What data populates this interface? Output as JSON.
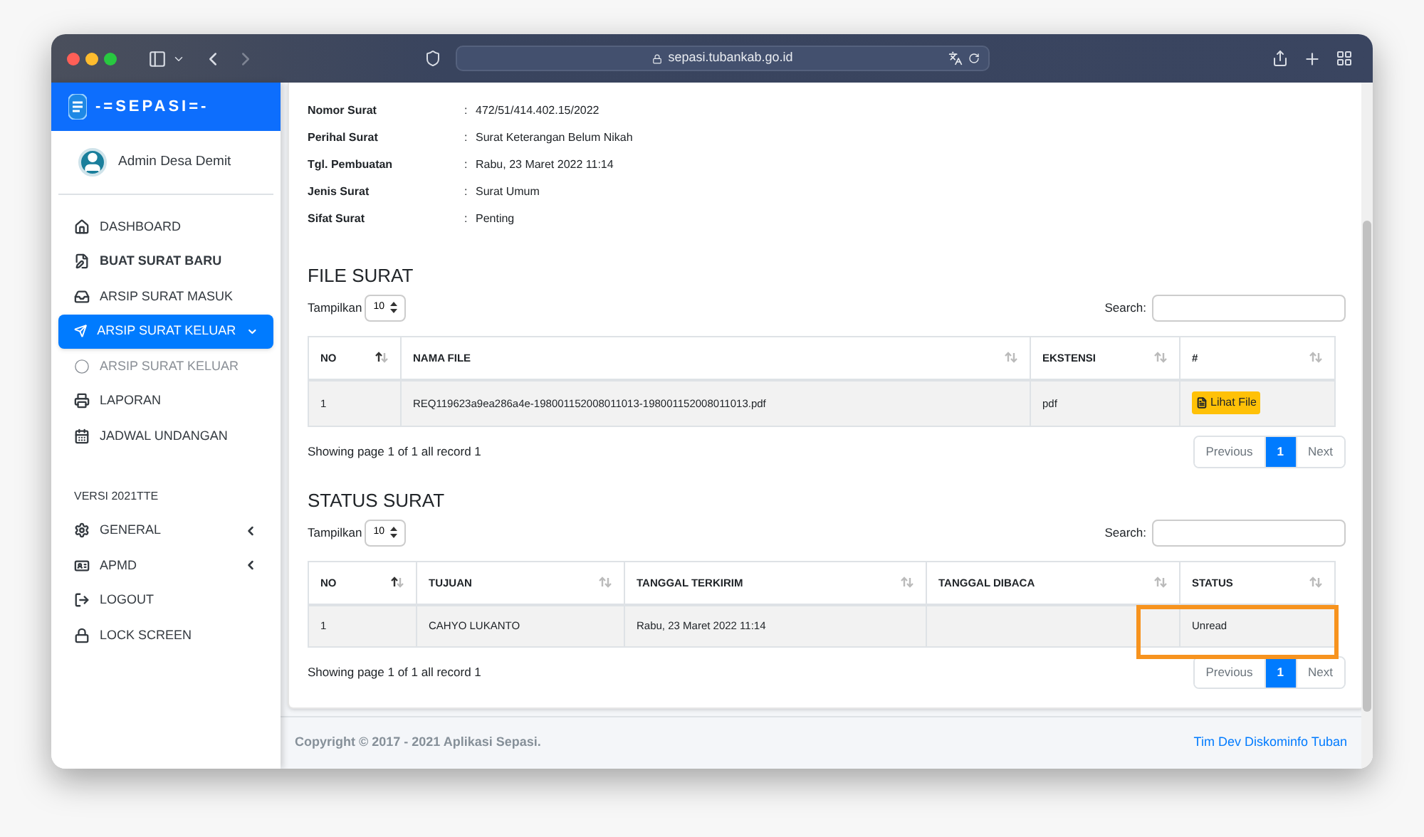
{
  "browser": {
    "url": "sepasi.tubankab.go.id"
  },
  "sidebar": {
    "logo": "-=SEPASI=-",
    "user": "Admin Desa Demit",
    "items": [
      {
        "kind": "item",
        "label": "DASHBOARD",
        "selected": false,
        "bold": false
      },
      {
        "kind": "item",
        "label": "BUAT SURAT BARU",
        "selected": false,
        "bold": true
      },
      {
        "kind": "item",
        "label": "ARSIP SURAT MASUK",
        "selected": false,
        "bold": false
      },
      {
        "kind": "submenu",
        "label": "ARSIP SURAT KELUAR",
        "selected": true,
        "bold": false,
        "expanded": true
      },
      {
        "kind": "subitem",
        "label": "ARSIP SURAT KELUAR",
        "selected": false,
        "bold": false
      },
      {
        "kind": "item",
        "label": "LAPORAN",
        "selected": false,
        "bold": false
      },
      {
        "kind": "item",
        "label": "JADWAL UNDANGAN",
        "selected": false,
        "bold": false
      }
    ],
    "section": "VERSI 2021TTE",
    "items2": [
      {
        "kind": "submenu",
        "label": "GENERAL",
        "selected": false,
        "bold": false,
        "expanded": false
      },
      {
        "kind": "submenu",
        "label": "APMD",
        "selected": false,
        "bold": false,
        "expanded": false
      },
      {
        "kind": "item",
        "label": "LOGOUT",
        "selected": false,
        "bold": false
      },
      {
        "kind": "item",
        "label": "LOCK SCREEN",
        "selected": false,
        "bold": false
      }
    ]
  },
  "details": [
    {
      "label": "Nomor Surat",
      "sep": ":",
      "value": "472/51/414.402.15/2022"
    },
    {
      "label": "Perihal Surat",
      "sep": ":",
      "value": "Surat Keterangan Belum Nikah"
    },
    {
      "label": "Tgl. Pembuatan",
      "sep": ":",
      "value": "Rabu, 23 Maret 2022 11:14"
    },
    {
      "label": "Jenis Surat",
      "sep": ":",
      "value": "Surat Umum"
    },
    {
      "label": "Sifat Surat",
      "sep": ":",
      "value": "Penting"
    }
  ],
  "tables": [
    {
      "title": "FILE SURAT",
      "length_label": "Tampilkan",
      "length_value": "10",
      "search_label": "Search:",
      "columns": [
        {
          "label": "NO",
          "sorted": true
        },
        {
          "label": "NAMA FILE",
          "sorted": false
        },
        {
          "label": "EKSTENSI",
          "sorted": false
        },
        {
          "label": "#",
          "sorted": false
        }
      ],
      "rows": [
        [
          {
            "kind": "text",
            "text": "1"
          },
          {
            "kind": "text",
            "text": "REQ119623a9ea286a4e-198001152008011013-198001152008011013.pdf"
          },
          {
            "kind": "text",
            "text": "pdf"
          },
          {
            "kind": "button",
            "text": "Lihat File"
          }
        ]
      ],
      "info": "Showing page 1 of 1 all record 1",
      "pages": [
        {
          "label": "Previous",
          "selected": false
        },
        {
          "label": "1",
          "selected": true
        },
        {
          "label": "Next",
          "selected": false
        }
      ]
    },
    {
      "title": "STATUS SURAT",
      "length_label": "Tampilkan",
      "length_value": "10",
      "search_label": "Search:",
      "columns": [
        {
          "label": "NO",
          "sorted": true
        },
        {
          "label": "TUJUAN",
          "sorted": false
        },
        {
          "label": "TANGGAL TERKIRIM",
          "sorted": false
        },
        {
          "label": "TANGGAL DIBACA",
          "sorted": false
        },
        {
          "label": "STATUS",
          "sorted": false
        }
      ],
      "rows": [
        [
          {
            "kind": "text",
            "text": "1"
          },
          {
            "kind": "text",
            "text": "CAHYO LUKANTO"
          },
          {
            "kind": "text",
            "text": "Rabu, 23 Maret 2022 11:14"
          },
          {
            "kind": "text",
            "text": ""
          },
          {
            "kind": "text",
            "text": "Unread"
          }
        ]
      ],
      "info": "Showing page 1 of 1 all record 1",
      "pages": [
        {
          "label": "Previous",
          "selected": false
        },
        {
          "label": "1",
          "selected": true
        },
        {
          "label": "Next",
          "selected": false
        }
      ]
    }
  ],
  "footer": {
    "copyright": "Copyright © 2017 - 2021 Aplikasi Sepasi.",
    "credit": "Tim Dev Diskominfo Tuban"
  }
}
